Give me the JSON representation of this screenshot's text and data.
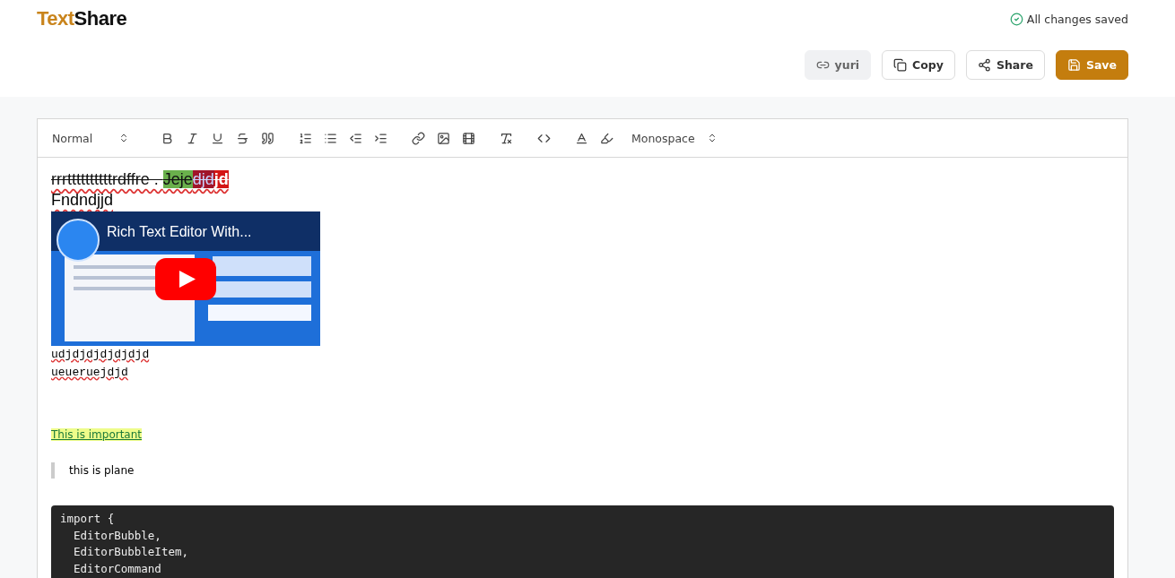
{
  "header": {
    "logo": {
      "accent": "Text",
      "rest": "Share"
    },
    "status": "All changes saved"
  },
  "actions": [
    {
      "kind": "link",
      "label": "yuri"
    },
    {
      "kind": "copy",
      "label": "Copy"
    },
    {
      "kind": "share",
      "label": "Share"
    },
    {
      "kind": "save",
      "label": "Save"
    }
  ],
  "toolbar": {
    "block_style": "Normal",
    "font": "Monospace"
  },
  "document": {
    "first_line": [
      {
        "text": "rrrttttttttttrdffre . ",
        "kind": "plain",
        "strike": true
      },
      {
        "text": "Jeje",
        "kind": "green",
        "strike": true
      },
      {
        "text": "djd",
        "kind": "blue-on-red",
        "strike": true
      },
      {
        "text": "jd",
        "kind": "white-on-red",
        "strike": true
      }
    ],
    "second_line": "Fndndjjd",
    "video": {
      "title": "Rich Text Editor With..."
    },
    "mono_lines": [
      "udjdjdjdjdjdjd",
      "ueueruejdjd"
    ],
    "highlight": "This is important",
    "quote": "this is plane",
    "code": [
      "import {",
      "  EditorBubble,",
      "  EditorBubbleItem,",
      "  EditorCommand"
    ]
  }
}
